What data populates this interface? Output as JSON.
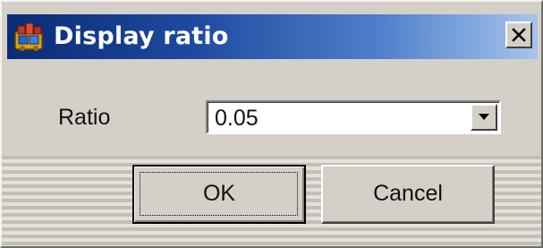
{
  "window": {
    "title": "Display ratio",
    "close_label": "×",
    "title_icon": "app-icon",
    "titlebar_gradient": [
      "#0a2b75",
      "#a6c4ec"
    ]
  },
  "form": {
    "ratio_label": "Ratio",
    "ratio_value": "0.05",
    "dropdown_icon": "chevron-down-icon"
  },
  "buttons": {
    "ok_label": "OK",
    "cancel_label": "Cancel"
  }
}
